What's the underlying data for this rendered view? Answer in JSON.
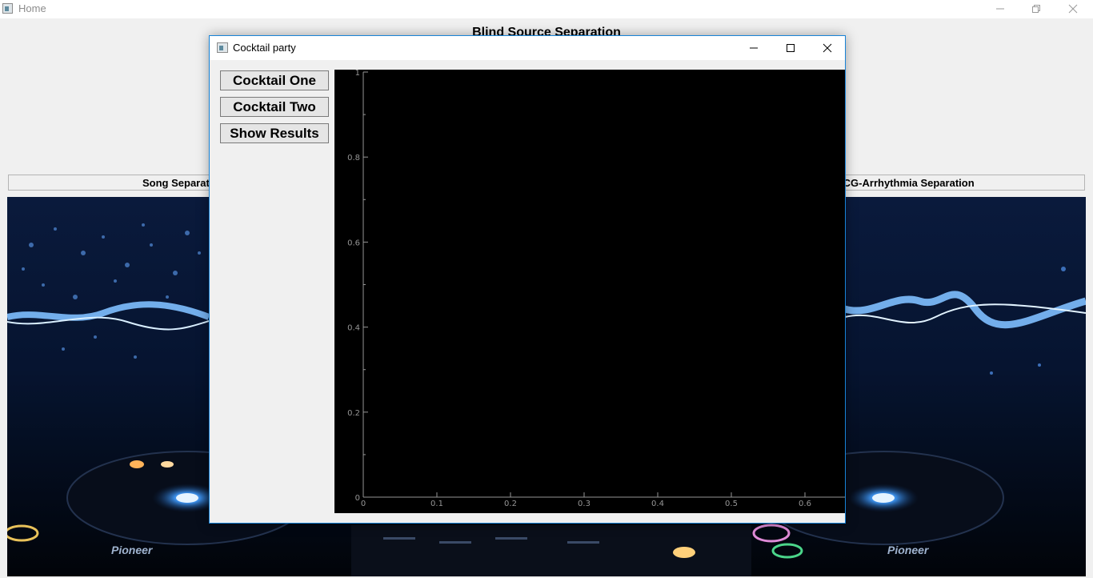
{
  "window": {
    "title": "Home",
    "controls": [
      "minimize-icon",
      "restore-icon",
      "close-icon"
    ]
  },
  "app_title": "Blind Source Separation",
  "tabs": [
    {
      "label": "Song Separation"
    },
    {
      "label": "ECG-Arrhythmia Separation"
    }
  ],
  "dialog": {
    "title": "Cocktail party",
    "controls": [
      "minimize-icon",
      "maximize-icon",
      "close-icon"
    ],
    "buttons": {
      "cocktail_one": "Cocktail One",
      "cocktail_two": "Cocktail Two",
      "show_results": "Show Results"
    }
  },
  "chart_data": {
    "type": "line",
    "title": "",
    "xlabel": "",
    "ylabel": "",
    "xlim": [
      0,
      0.65
    ],
    "ylim": [
      0,
      1
    ],
    "x_ticks": [
      "0",
      "0.1",
      "0.2",
      "0.3",
      "0.4",
      "0.5",
      "0.6"
    ],
    "y_ticks": [
      "0",
      "0.2",
      "0.4",
      "0.6",
      "0.8",
      "1"
    ],
    "series": [],
    "background": "#000000",
    "axis_color": "#969696",
    "grid": false
  },
  "colors": {
    "accent_border": "#1883d7",
    "window_bg": "#f0f0f0"
  }
}
